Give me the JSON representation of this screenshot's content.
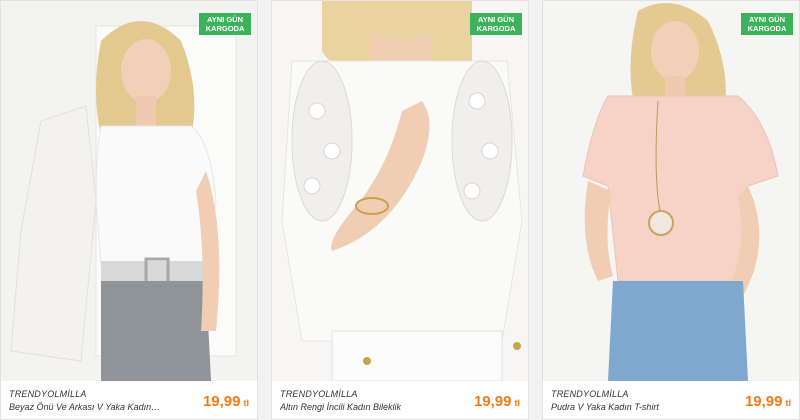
{
  "products": [
    {
      "badge": "AYNI GÜN KARGODA",
      "brand": "TRENDYOLMİLLA",
      "title": "Beyaz Önü Ve Arkası V Yaka Kadın…",
      "price": "19,99",
      "currency": "tl"
    },
    {
      "badge": "AYNI GÜN KARGODA",
      "brand": "TRENDYOLMİLLA",
      "title": "Altın Rengi İncili Kadın Bileklik",
      "price": "19,99",
      "currency": "tl"
    },
    {
      "badge": "AYNI GÜN KARGODA",
      "brand": "TRENDYOLMİLLA",
      "title": "Pudra V Yaka Kadın T-shirt",
      "price": "19,99",
      "currency": "tl"
    }
  ],
  "colors": {
    "badge_green": "#3cb35a",
    "price_orange": "#f27a1a"
  }
}
